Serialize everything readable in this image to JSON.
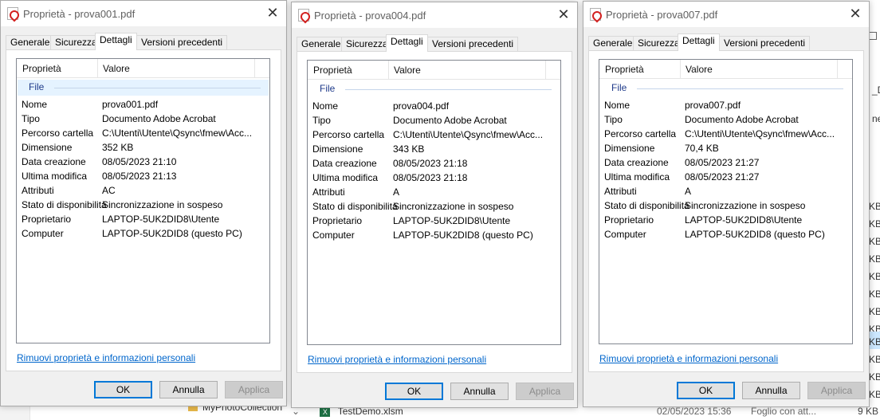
{
  "dialogs": [
    {
      "title": "Proprietà - prova001.pdf",
      "tabs": [
        "Generale",
        "Sicurezza",
        "Dettagli",
        "Versioni precedenti"
      ],
      "active_tab": 2,
      "columns": {
        "property": "Proprietà",
        "value": "Valore"
      },
      "group": "File",
      "rows": [
        {
          "name": "Nome",
          "value": "prova001.pdf"
        },
        {
          "name": "Tipo",
          "value": "Documento Adobe Acrobat"
        },
        {
          "name": "Percorso cartella",
          "value": "C:\\Utenti\\Utente\\Qsync\\fmew\\Acc..."
        },
        {
          "name": "Dimensione",
          "value": "352 KB"
        },
        {
          "name": "Data creazione",
          "value": "08/05/2023 21:10"
        },
        {
          "name": "Ultima modifica",
          "value": "08/05/2023 21:13"
        },
        {
          "name": "Attributi",
          "value": "AC"
        },
        {
          "name": "Stato di disponibilità",
          "value": "Sincronizzazione in sospeso"
        },
        {
          "name": "Proprietario",
          "value": "LAPTOP-5UK2DID8\\Utente"
        },
        {
          "name": "Computer",
          "value": "LAPTOP-5UK2DID8 (questo PC)"
        }
      ],
      "link": "Rimuovi proprietà e informazioni personali",
      "buttons": {
        "ok": "OK",
        "cancel": "Annulla",
        "apply": "Applica"
      }
    },
    {
      "title": "Proprietà - prova004.pdf",
      "tabs": [
        "Generale",
        "Sicurezza",
        "Dettagli",
        "Versioni precedenti"
      ],
      "active_tab": 2,
      "columns": {
        "property": "Proprietà",
        "value": "Valore"
      },
      "group": "File",
      "rows": [
        {
          "name": "Nome",
          "value": "prova004.pdf"
        },
        {
          "name": "Tipo",
          "value": "Documento Adobe Acrobat"
        },
        {
          "name": "Percorso cartella",
          "value": "C:\\Utenti\\Utente\\Qsync\\fmew\\Acc..."
        },
        {
          "name": "Dimensione",
          "value": "343 KB"
        },
        {
          "name": "Data creazione",
          "value": "08/05/2023 21:18"
        },
        {
          "name": "Ultima modifica",
          "value": "08/05/2023 21:18"
        },
        {
          "name": "Attributi",
          "value": "A"
        },
        {
          "name": "Stato di disponibilità",
          "value": "Sincronizzazione in sospeso"
        },
        {
          "name": "Proprietario",
          "value": "LAPTOP-5UK2DID8\\Utente"
        },
        {
          "name": "Computer",
          "value": "LAPTOP-5UK2DID8 (questo PC)"
        }
      ],
      "link": "Rimuovi proprietà e informazioni personali",
      "buttons": {
        "ok": "OK",
        "cancel": "Annulla",
        "apply": "Applica"
      }
    },
    {
      "title": "Proprietà - prova007.pdf",
      "tabs": [
        "Generale",
        "Sicurezza",
        "Dettagli",
        "Versioni precedenti"
      ],
      "active_tab": 2,
      "columns": {
        "property": "Proprietà",
        "value": "Valore"
      },
      "group": "File",
      "rows": [
        {
          "name": "Nome",
          "value": "prova007.pdf"
        },
        {
          "name": "Tipo",
          "value": "Documento Adobe Acrobat"
        },
        {
          "name": "Percorso cartella",
          "value": "C:\\Utenti\\Utente\\Qsync\\fmew\\Acc..."
        },
        {
          "name": "Dimensione",
          "value": "70,4 KB"
        },
        {
          "name": "Data creazione",
          "value": "08/05/2023 21:27"
        },
        {
          "name": "Ultima modifica",
          "value": "08/05/2023 21:27"
        },
        {
          "name": "Attributi",
          "value": "A"
        },
        {
          "name": "Stato di disponibilità",
          "value": "Sincronizzazione in sospeso"
        },
        {
          "name": "Proprietario",
          "value": "LAPTOP-5UK2DID8\\Utente"
        },
        {
          "name": "Computer",
          "value": "LAPTOP-5UK2DID8 (questo PC)"
        }
      ],
      "link": "Rimuovi proprietà e informazioni personali",
      "buttons": {
        "ok": "OK",
        "cancel": "Annulla",
        "apply": "Applica"
      }
    }
  ],
  "background": {
    "folder_name": "MyPhotoCollection",
    "file_name": "TestDemo.xlsm",
    "file_date": "02/05/2023 15:36",
    "file_type": "Foglio con att...",
    "file_size": "9 KB",
    "size_unit": "KB",
    "fragment": "ne",
    "fragment2": "_D"
  },
  "colors": {
    "link": "#0066cc",
    "ok_border": "#0078d7",
    "group_highlight": "#e5f3ff"
  }
}
